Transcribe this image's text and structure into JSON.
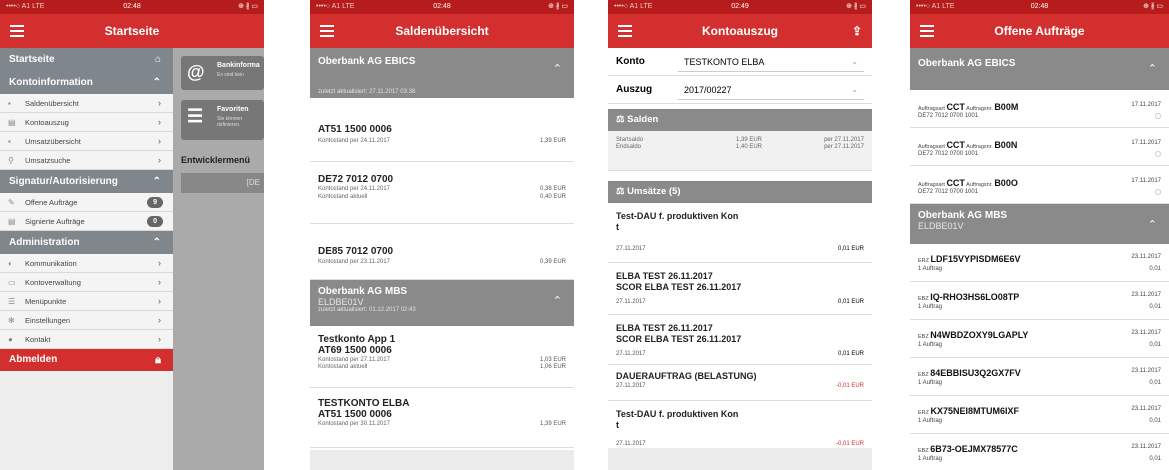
{
  "status": {
    "carrier": "••••○ A1 LTE",
    "bt": "⊕ ∦ ▭"
  },
  "p1": {
    "time": "02:48",
    "title": "Startseite",
    "sections": [
      {
        "label": "Startseite",
        "icon": "home-icon"
      },
      {
        "label": "Kontoinformation",
        "items": [
          "Saldenübersicht",
          "Kontoauszug",
          "Umsatzübersicht",
          "Umsatzsuche"
        ]
      },
      {
        "label": "Signatur/Autorisierung",
        "items": [
          "Offene Aufträge",
          "Signierte Aufträge"
        ],
        "badges": [
          "9",
          "0"
        ]
      },
      {
        "label": "Administration",
        "items": [
          "Kommunikation",
          "Kontoverwaltung",
          "Menüpunkte",
          "Einstellungen",
          "Kontakt"
        ]
      }
    ],
    "logout": "Abmelden",
    "cards": [
      {
        "title": "Bankinforma",
        "sub": "Es sind kein"
      },
      {
        "title": "Favoriten",
        "sub": "Sie können\ndefinieren."
      }
    ],
    "dev": "Entwicklermenü",
    "devbtn": "[DE"
  },
  "p2": {
    "time": "02:48",
    "title": "Saldenübersicht",
    "g1": {
      "name": "Oberbank AG EBICS",
      "updated": "zuletzt aktualisiert: 27.11.2017 03:38"
    },
    "a1": [
      {
        "iban": "AT51 1500 0006",
        "l1": "Kontostand per 24.11.2017",
        "v1": "1,39 EUR"
      },
      {
        "iban": "DE72 7012 0700",
        "l1": "Kontostand per 24.11.2017",
        "v1": "0,38 EUR",
        "l2": "Kontostand aktuell",
        "v2": "0,40 EUR"
      },
      {
        "iban": "DE85 7012 0700",
        "l1": "Kontostand per 23.11.2017",
        "v1": "0,39 EUR"
      }
    ],
    "g2": {
      "name": "Oberbank AG MBS",
      "sub": "ELDBE01V",
      "updated": "zuletzt aktualisiert: 01.12.2017 02:43"
    },
    "a2": [
      {
        "name": "Testkonto App 1",
        "iban": "AT69 1500 0006",
        "l1": "Kontostand per 27.11.2017",
        "v1": "1,03 EUR",
        "l2": "Kontostand aktuell",
        "v2": "1,06 EUR"
      },
      {
        "name": "TESTKONTO ELBA",
        "iban": "AT51 1500 0006",
        "l1": "Kontostand per 30.11.2017",
        "v1": "1,39 EUR"
      }
    ]
  },
  "p3": {
    "time": "02:49",
    "title": "Kontoauszug",
    "konto_label": "Konto",
    "konto": "TESTKONTO ELBA",
    "auszug_label": "Auszug",
    "auszug": "2017/00227",
    "salden": "Salden",
    "start": {
      "l": "Startsaldo",
      "v": "1,39 EUR",
      "d": "per 27.11.2017"
    },
    "end": {
      "l": "Endsaldo",
      "v": "1,40 EUR",
      "d": "per 27.11.2017"
    },
    "umsaetze": "Umsätze (5)",
    "tx": [
      {
        "n": "Test-DAU f. produktiven Kon\nt",
        "d": "27.11.2017",
        "a": "0,01 EUR"
      },
      {
        "n": "ELBA TEST 26.11.2017\nSCOR ELBA TEST 26.11.2017",
        "d": "27.11.2017",
        "a": "0,01 EUR"
      },
      {
        "n": "ELBA TEST 26.11.2017\nSCOR ELBA TEST 26.11.2017",
        "d": "27.11.2017",
        "a": "0,01 EUR"
      },
      {
        "n": "DAUERAUFTRAG (BELASTUNG)",
        "d": "27.11.2017",
        "a": "-0,01 EUR"
      },
      {
        "n": "Test-DAU f. produktiven Kon\nt",
        "d": "27.11.2017",
        "a": "-0,01 EUR"
      }
    ]
  },
  "p4": {
    "time": "02:48",
    "title": "Offene Aufträge",
    "g1": "Oberbank AG EBICS",
    "ebics": [
      {
        "art": "CCT",
        "nr": "B00M",
        "iban": "DE72 7012 0700 1001",
        "d": "17.11.2017"
      },
      {
        "art": "CCT",
        "nr": "B00N",
        "iban": "DE72 7012 0700 1001",
        "d": "17.11.2017"
      },
      {
        "art": "CCT",
        "nr": "B00O",
        "iban": "DE72 7012 0700 1001",
        "d": "17.11.2017"
      }
    ],
    "art_label": "Auftragsart",
    "nr_label": "Auftragsnr.",
    "g2": "Oberbank AG MBS",
    "g2sub": "ELDBE01V",
    "mbs": [
      {
        "p": "ERZ",
        "id": "LDF15VYPISDM6E6V",
        "c": "1 Auftrag",
        "d": "23.11.2017",
        "v": "0,01"
      },
      {
        "p": "EBZ",
        "id": "IQ-RHO3HS6LO08TP",
        "c": "1 Auftrag",
        "d": "23.11.2017",
        "v": "0,01"
      },
      {
        "p": "EBZ",
        "id": "N4WBDZOXY9LGAPLY",
        "c": "1 Auftrag",
        "d": "23.11.2017",
        "v": "0,01"
      },
      {
        "p": "EBZ",
        "id": "84EBBISU3Q2GX7FV",
        "c": "1 Auftrag",
        "d": "23.11.2017",
        "v": "0,01"
      },
      {
        "p": "ERZ",
        "id": "KX75NEI8MTUM6IXF",
        "c": "1 Auftrag",
        "d": "23.11.2017",
        "v": "0,01"
      },
      {
        "p": "EBZ",
        "id": "6B73-OEJMX78577C",
        "c": "1 Auftrag",
        "d": "23.11.2017",
        "v": "0,01"
      }
    ]
  }
}
